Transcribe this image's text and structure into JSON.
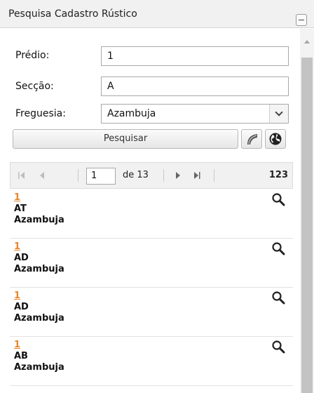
{
  "panel": {
    "title": "Pesquisa Cadastro Rústico"
  },
  "form": {
    "predio_label": "Prédio:",
    "predio_value": "1",
    "seccao_label": "Secção:",
    "seccao_value": "A",
    "freguesia_label": "Freguesia:",
    "freguesia_value": "Azambuja",
    "search_label": "Pesquisar"
  },
  "pager": {
    "page": "1",
    "of_label": "de 13",
    "total": "123"
  },
  "results": [
    {
      "predio": "1",
      "seccao": "AT",
      "freguesia": "Azambuja"
    },
    {
      "predio": "1",
      "seccao": "AD",
      "freguesia": "Azambuja"
    },
    {
      "predio": "1",
      "seccao": "AD",
      "freguesia": "Azambuja"
    },
    {
      "predio": "1",
      "seccao": "AB",
      "freguesia": "Azambuja"
    }
  ],
  "icons": {
    "collapse": "minus-icon",
    "draw": "draw-curve-icon",
    "globe": "globe-icon",
    "first": "first-page-icon",
    "prev": "prev-page-icon",
    "next": "next-page-icon",
    "last": "last-page-icon",
    "zoom": "zoom-icon"
  },
  "colors": {
    "link": "#e8862a",
    "header_bg": "#f1f1f1",
    "scrollbar_thumb": "#c3c3c3"
  }
}
